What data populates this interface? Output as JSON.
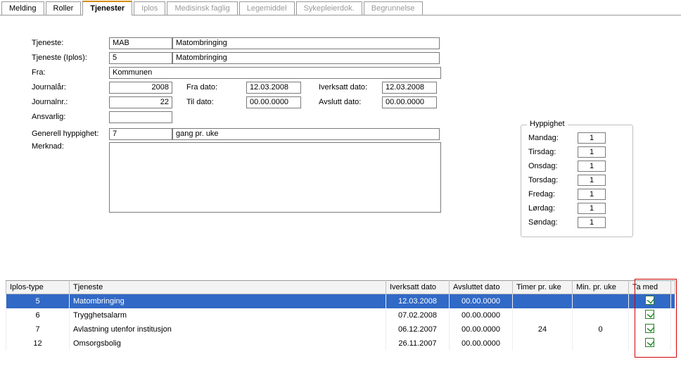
{
  "tabs": [
    {
      "label": "Melding",
      "active": false,
      "disabled": false
    },
    {
      "label": "Roller",
      "active": false,
      "disabled": false
    },
    {
      "label": "Tjenester",
      "active": true,
      "disabled": false
    },
    {
      "label": "Iplos",
      "active": false,
      "disabled": true
    },
    {
      "label": "Medisinsk faglig",
      "active": false,
      "disabled": true
    },
    {
      "label": "Legemiddel",
      "active": false,
      "disabled": true
    },
    {
      "label": "Sykepleierdok.",
      "active": false,
      "disabled": true
    },
    {
      "label": "Begrunnelse",
      "active": false,
      "disabled": true
    }
  ],
  "labels": {
    "tjeneste": "Tjeneste:",
    "tjeneste_iplos": "Tjeneste (Iplos):",
    "fra": "Fra:",
    "journalaar": "Journalår:",
    "journalnr": "Journalnr.:",
    "ansvarlig": "Ansvarlig:",
    "generell": "Generell hyppighet:",
    "merknad": "Merknad:",
    "fra_dato": "Fra dato:",
    "til_dato": "Til dato:",
    "iverksatt_dato": "Iverksatt dato:",
    "avslutt_dato": "Avslutt dato:",
    "gang_uke": "gang pr. uke"
  },
  "form": {
    "tjeneste_code": "MAB",
    "tjeneste_name": "Matombringing",
    "iplos_code": "5",
    "iplos_name": "Matombringing",
    "fra": "Kommunen",
    "journalaar": "2008",
    "journalnr": "22",
    "ansvarlig": "",
    "fra_dato": "12.03.2008",
    "til_dato": "00.00.0000",
    "iverksatt_dato": "12.03.2008",
    "avslutt_dato": "00.00.0000",
    "gen_hypp": "7",
    "merknad": ""
  },
  "hyppighet": {
    "title": "Hyppighet",
    "days": [
      {
        "label": "Mandag:",
        "value": "1"
      },
      {
        "label": "Tirsdag:",
        "value": "1"
      },
      {
        "label": "Onsdag:",
        "value": "1"
      },
      {
        "label": "Torsdag:",
        "value": "1"
      },
      {
        "label": "Fredag:",
        "value": "1"
      },
      {
        "label": "Lørdag:",
        "value": "1"
      },
      {
        "label": "Søndag:",
        "value": "1"
      }
    ]
  },
  "grid": {
    "headers": {
      "iplos": "Iplos-type",
      "tjeneste": "Tjeneste",
      "iverksatt": "Iverksatt dato",
      "avsluttet": "Avsluttet dato",
      "timer": "Timer pr. uke",
      "min": "Min. pr. uke",
      "tamed": "Ta med"
    },
    "rows": [
      {
        "iplos": "5",
        "tjeneste": "Matombringing",
        "iverksatt": "12.03.2008",
        "avsluttet": "00.00.0000",
        "timer": "",
        "min": "",
        "tamed": true,
        "selected": true
      },
      {
        "iplos": "6",
        "tjeneste": "Trygghetsalarm",
        "iverksatt": "07.02.2008",
        "avsluttet": "00.00.0000",
        "timer": "",
        "min": "",
        "tamed": true,
        "selected": false
      },
      {
        "iplos": "7",
        "tjeneste": "Avlastning utenfor institusjon",
        "iverksatt": "06.12.2007",
        "avsluttet": "00.00.0000",
        "timer": "24",
        "min": "0",
        "tamed": true,
        "selected": false
      },
      {
        "iplos": "12",
        "tjeneste": "Omsorgsbolig",
        "iverksatt": "26.11.2007",
        "avsluttet": "00.00.0000",
        "timer": "",
        "min": "",
        "tamed": true,
        "selected": false
      }
    ]
  }
}
